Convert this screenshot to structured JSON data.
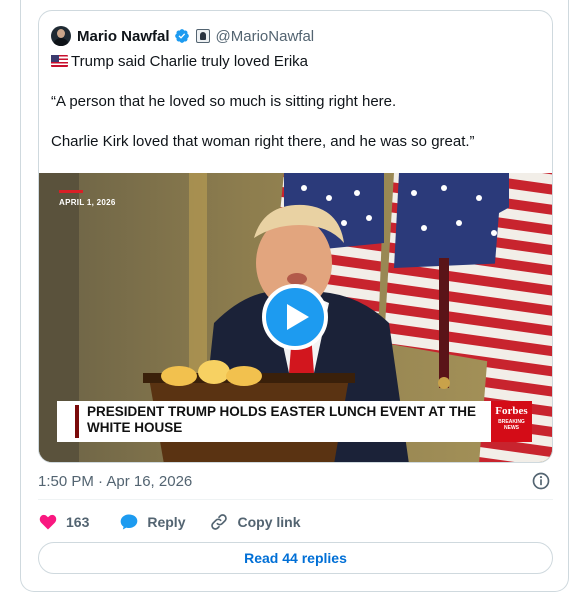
{
  "quoted": {
    "author": "Mario Nawfal",
    "handle": "@MarioNawfal",
    "lines": [
      "Trump said Charlie truly loved Erika",
      "“A person that he loved so much is sitting right here.",
      "Charlie Kirk loved that woman right there, and he was so great.”"
    ],
    "icons": {
      "flag": "us-flag-icon",
      "verified": "verified-badge-icon",
      "affiliation": "affiliate-badge-icon"
    },
    "video": {
      "date_tag": "APRIL 1, 2026",
      "banner": "PRESIDENT TRUMP HOLDS EASTER LUNCH EVENT AT THE WHITE HOUSE",
      "logo_name": "Forbes",
      "logo_sub": "BREAKING NEWS",
      "play_icon": "play-icon"
    }
  },
  "timestamp": "1:50 PM · Apr 16, 2026",
  "actions": {
    "likes": "163",
    "reply": "Reply",
    "copy": "Copy link"
  },
  "read_replies": "Read 44 replies",
  "colors": {
    "accent": "#1d9bf0",
    "like": "#f91880",
    "text": "#0f1419",
    "muted": "#536471",
    "link": "#006fd6"
  }
}
